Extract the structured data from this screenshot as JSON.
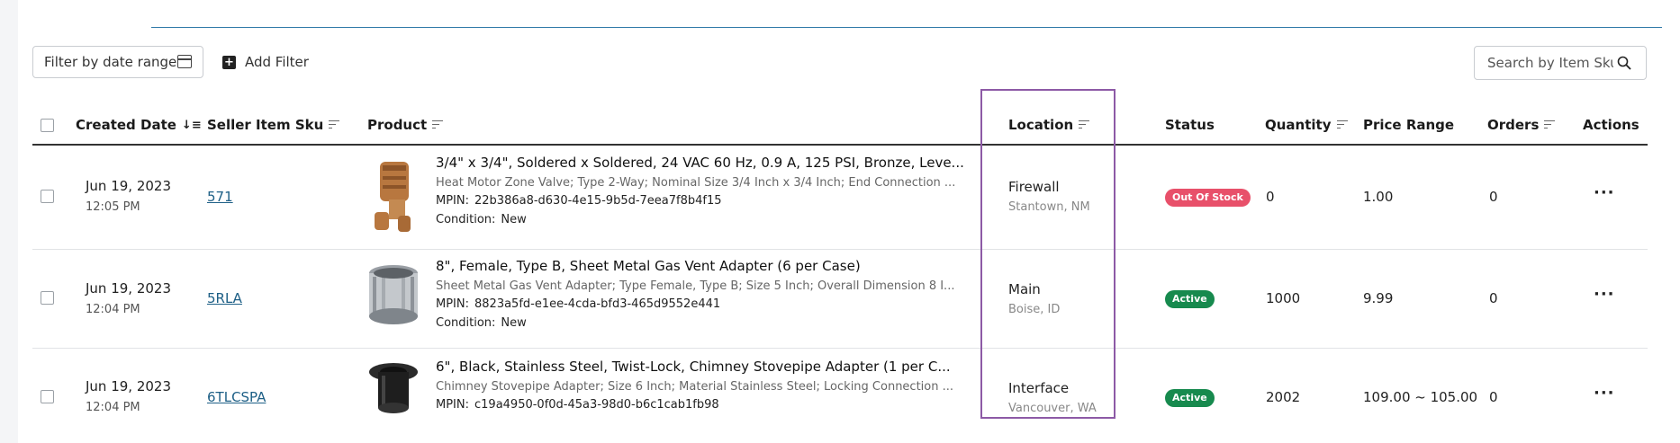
{
  "filters": {
    "date_range_label": "Filter by date range",
    "add_filter_label": "Add Filter",
    "search_placeholder": "Search by Item Sku"
  },
  "table": {
    "headers": {
      "created_date": "Created Date",
      "seller_item_sku": "Seller Item Sku",
      "product": "Product",
      "location": "Location",
      "status": "Status",
      "quantity": "Quantity",
      "price_range": "Price Range",
      "orders": "Orders",
      "actions": "Actions"
    },
    "rows": [
      {
        "date": "Jun 19, 2023",
        "time": "12:05 PM",
        "sku": "571",
        "product_title": "3/4\" x 3/4\", Soldered x Soldered, 24 VAC 60 Hz, 0.9 A, 125 PSI, Bronze, Leve...",
        "product_desc": "Heat Motor Zone Valve; Type 2-Way; Nominal Size 3/4 Inch x 3/4 Inch; End Connection ...",
        "mpin_label": "MPIN:",
        "mpin": "22b386a8-d630-4e15-9b5d-7eea7f8b4f15",
        "condition_label": "Condition:",
        "condition": "New",
        "location_name": "Firewall",
        "location_city": "Stantown, NM",
        "status": "Out Of Stock",
        "status_color": "#e8506a",
        "quantity": "0",
        "price_range": "1.00",
        "orders": "0",
        "thumb_icon": "zone-valve-product-image"
      },
      {
        "date": "Jun 19, 2023",
        "time": "12:04 PM",
        "sku": "5RLA",
        "product_title": "8\", Female, Type B, Sheet Metal Gas Vent Adapter (6 per Case)",
        "product_desc": "Sheet Metal Gas Vent Adapter; Type Female, Type B; Size 5 Inch; Overall Dimension 8 I...",
        "mpin_label": "MPIN:",
        "mpin": "8823a5fd-e1ee-4cda-bfd3-465d9552e441",
        "condition_label": "Condition:",
        "condition": "New",
        "location_name": "Main",
        "location_city": "Boise, ID",
        "status": "Active",
        "status_color": "#178a4e",
        "quantity": "1000",
        "price_range": "9.99",
        "orders": "0",
        "thumb_icon": "vent-adapter-product-image"
      },
      {
        "date": "Jun 19, 2023",
        "time": "12:04 PM",
        "sku": "6TLCSPA",
        "product_title": "6\", Black, Stainless Steel, Twist-Lock, Chimney Stovepipe Adapter (1 per C...",
        "product_desc": "Chimney Stovepipe Adapter; Size 6 Inch; Material Stainless Steel; Locking Connection ...",
        "mpin_label": "MPIN:",
        "mpin": "c19a4950-0f0d-45a3-98d0-b6c1cab1fb98",
        "location_name": "Interface",
        "location_city": "Vancouver, WA",
        "status": "Active",
        "status_color": "#178a4e",
        "quantity": "2002",
        "price_range": "109.00 ~ 105.00",
        "orders": "0",
        "thumb_icon": "stovepipe-adapter-product-image"
      }
    ]
  },
  "colors": {
    "link": "#1d5f86",
    "highlight_border": "#8d5aa6",
    "active_badge": "#178a4e",
    "out_of_stock_badge": "#e8506a"
  }
}
